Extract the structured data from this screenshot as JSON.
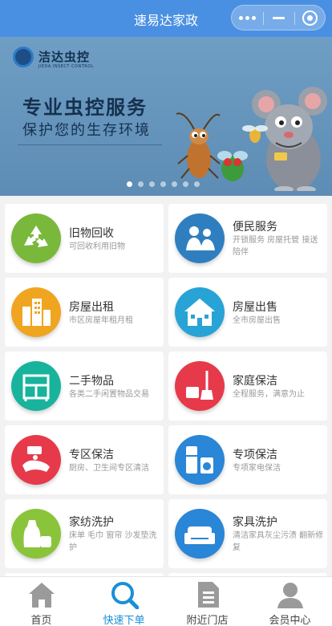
{
  "app": {
    "title": "速易达家政"
  },
  "capsule": {
    "more_icon": "more-dots-icon",
    "minimize_icon": "minimize-icon",
    "close_icon": "target-close-icon"
  },
  "banner": {
    "logo_name": "洁达虫控",
    "logo_sub": "JIEDA INSECT CONTROL",
    "headline": "专业虫控服务",
    "subline": "保护您的生存环境",
    "slides": 7,
    "active_slide": 0
  },
  "services": [
    {
      "title": "旧物回收",
      "desc": "可回收利用旧物",
      "icon": "recycle-icon",
      "color": "#7ab83b"
    },
    {
      "title": "便民服务",
      "desc": "开锁服务 房屋托管 接送陪伴",
      "icon": "people-icon",
      "color": "#2f7fc0"
    },
    {
      "title": "房屋出租",
      "desc": "市区房屋年租月租",
      "icon": "buildings-icon",
      "color": "#f0a520"
    },
    {
      "title": "房屋出售",
      "desc": "全市房屋出售",
      "icon": "house-icon",
      "color": "#28a3d6"
    },
    {
      "title": "二手物品",
      "desc": "各类二手闲置物品交易",
      "icon": "cabinet-icon",
      "color": "#18b39c"
    },
    {
      "title": "家庭保洁",
      "desc": "全程服务，满意为止",
      "icon": "broom-icon",
      "color": "#e63a4b"
    },
    {
      "title": "专区保洁",
      "desc": "厨房、卫生间专区清洁",
      "icon": "hand-cleaning-icon",
      "color": "#e63a4b"
    },
    {
      "title": "专项保洁",
      "desc": "专项家电保洁",
      "icon": "appliance-icon",
      "color": "#2a86d6"
    },
    {
      "title": "家纺洗护",
      "desc": "床单 毛巾 窗帘 沙发垫洗护",
      "icon": "detergent-icon",
      "color": "#8ac43a"
    },
    {
      "title": "家具洗护",
      "desc": "清洁家具灰尘污渍 翻新修复",
      "icon": "sofa-icon",
      "color": "#2a86d6"
    }
  ],
  "tabs": [
    {
      "label": "首页",
      "icon": "home-icon",
      "active": false
    },
    {
      "label": "快速下单",
      "icon": "search-icon",
      "active": true
    },
    {
      "label": "附近门店",
      "icon": "document-icon",
      "active": false
    },
    {
      "label": "会员中心",
      "icon": "user-icon",
      "active": false
    }
  ],
  "colors": {
    "titlebar": "#4a90e2",
    "accent": "#1a8fd6",
    "tab_inactive": "#9a9a9a"
  }
}
